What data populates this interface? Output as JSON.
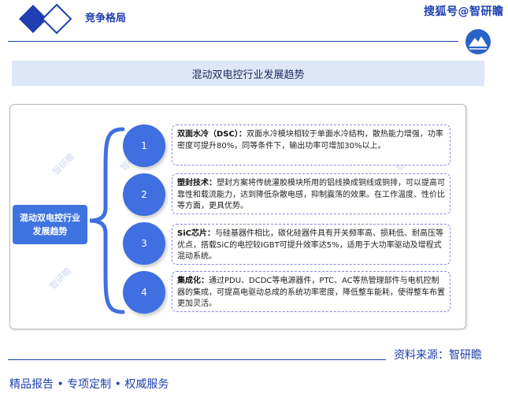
{
  "header": {
    "section_title": "竞争格局",
    "watermark": "搜狐号@智研瞻",
    "logo_icon": "double-diamond-icon",
    "badge_icon": "mountain-badge-icon",
    "accent_color": "#1f3fb0"
  },
  "title": "混动双电控行业发展趋势",
  "side_label": "混动双电控行业发展趋势",
  "bg_watermark": "智研瞻",
  "items": [
    {
      "num": "1",
      "label": "双面水冷（DSC）：",
      "text": "双面水冷模块相较于单面水冷结构，散热能力增强，功率密度可提升80%，同等条件下，输出功率可增加30%以上。"
    },
    {
      "num": "2",
      "label": "塑封技术：",
      "text": "塑封方案将传统灌胶模块所用的铝线换成铜线或铜排，可以提高可靠性和载流能力，达到降低杂散电感，抑制震荡的效果。在工作温度、性价比等方面，更具优势。"
    },
    {
      "num": "3",
      "label": "SiC芯片：",
      "text": "与硅基器件相比，碳化硅器件具有开关频率高、损耗低、耐高压等优点，搭载SiC的电控较IGBT可提升效率达5%，适用于大功率驱动及增程式混动系统。"
    },
    {
      "num": "4",
      "label": "集成化：",
      "text": "通过PDU、DCDC等电源器件，PTC、AC等热管理部件与电机控制器的集成，可提高电驱动总成的系统功率密度，降低整车能耗，使得整车布置更加灵活。"
    }
  ],
  "source": "资料来源：智研瞻",
  "footer": "精品报告 •   专项定制 • 权威服务"
}
